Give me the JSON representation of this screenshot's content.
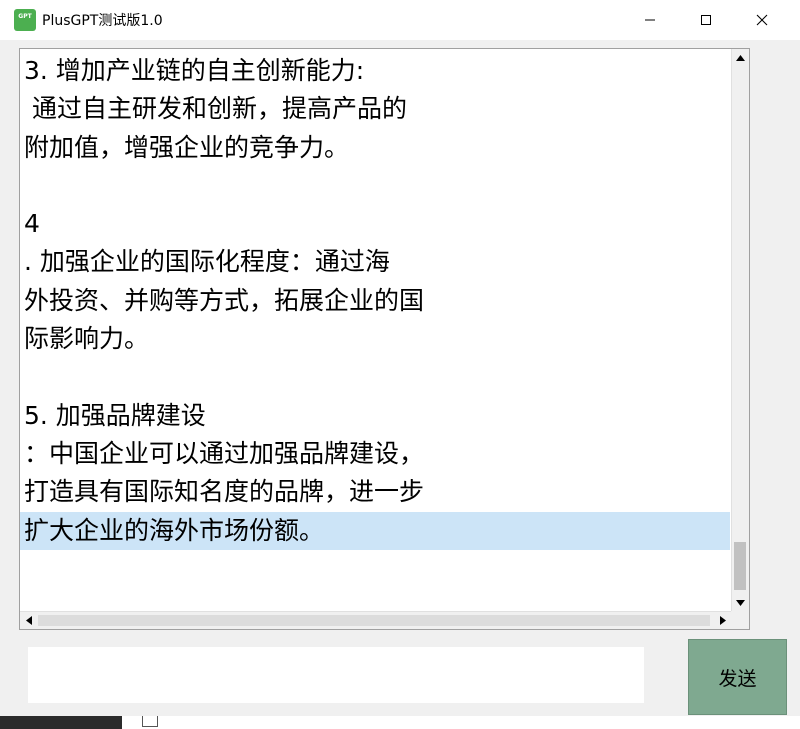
{
  "window": {
    "title": "PlusGPT测试版1.0",
    "icon_label": "GPT"
  },
  "titlebar_controls": {
    "minimize": "minimize-icon",
    "maximize": "maximize-icon",
    "close": "close-icon"
  },
  "output": {
    "lines": [
      "3. 增加产业链的自主创新能力:",
      " 通过自主研发和创新，提高产品的",
      "附加值，增强企业的竞争力。",
      "",
      "4",
      ". 加强企业的国际化程度：通过海",
      "外投资、并购等方式，拓展企业的国",
      "际影响力。",
      "",
      "5. 加强品牌建设",
      "：中国企业可以通过加强品牌建设，",
      "打造具有国际知名度的品牌，进一步",
      "扩大企业的海外市场份额。",
      ""
    ],
    "selected_line_index": 12
  },
  "input": {
    "value": "",
    "placeholder": ""
  },
  "send_button": {
    "label": "发送"
  },
  "colors": {
    "send_button_bg": "#7fa990",
    "selection_bg": "#cce4f7",
    "icon_green": "#4caf50"
  }
}
